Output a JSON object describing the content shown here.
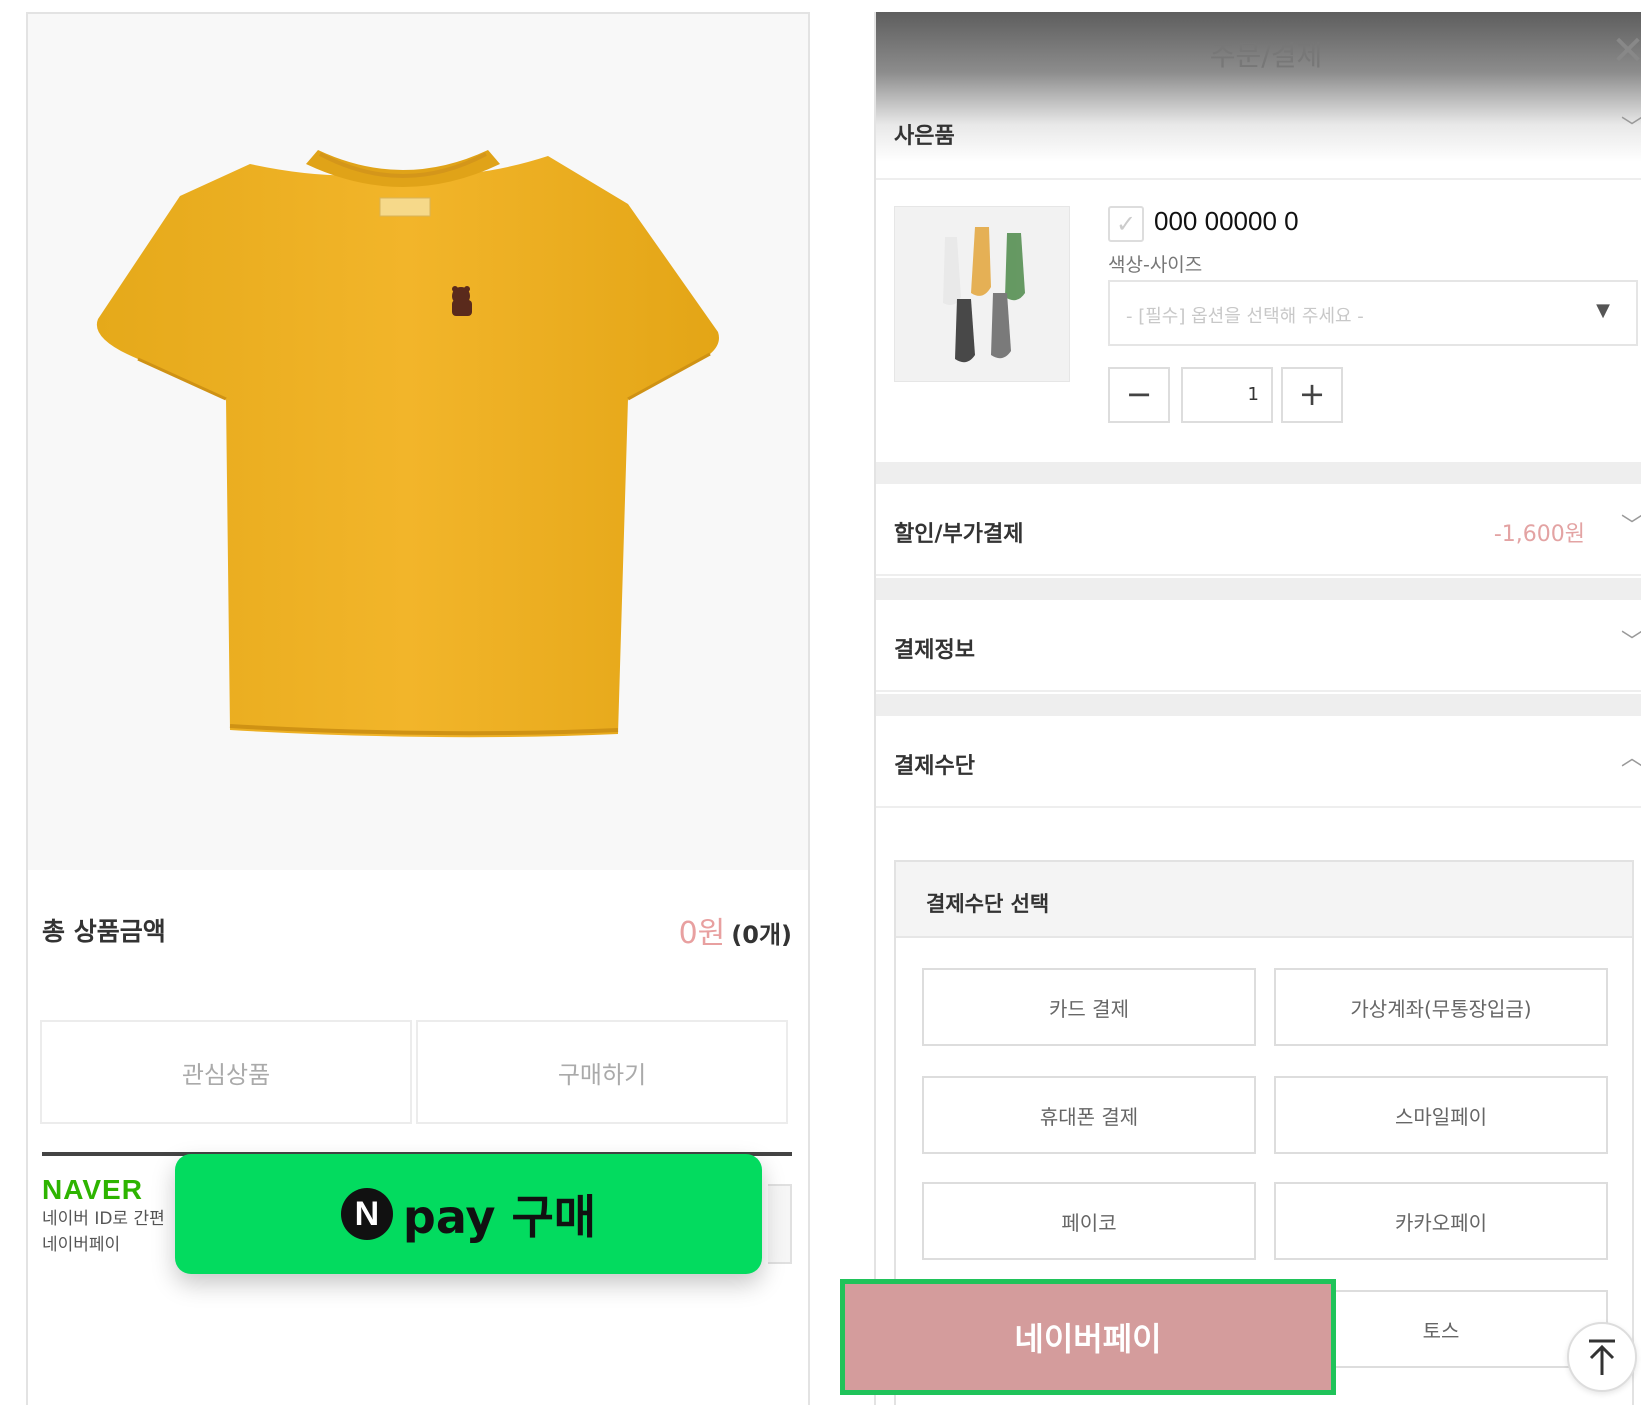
{
  "product": {
    "total_label": "총 상품금액",
    "total_price": "0원",
    "total_count": "(0개)",
    "wishlist_label": "관심상품",
    "buy_label": "구매하기",
    "naver_logo": "NAVER",
    "naver_desc_line1": "네이버 ID로 간편",
    "naver_desc_line2": "네이버페이",
    "npay_label": "pay 구매",
    "npay_logo_letter": "N",
    "image_icon": "yellow-tshirt-image"
  },
  "order": {
    "title": "주문/결제",
    "close_icon": "close-icon",
    "sections": {
      "gift": "사은품",
      "discount": "할인/부가결제",
      "discount_amount": "-1,600원",
      "payment_info": "결제정보",
      "payment_method": "결제수단"
    },
    "gift_item": {
      "name": "000 00000 0",
      "option_label": "색상-사이즈",
      "option_placeholder": "- [필수] 옵션을 선택해 주세요 -",
      "quantity": "1",
      "minus_label": "−",
      "plus_label": "+"
    },
    "method_box_title": "결제수단 선택",
    "methods": [
      "카드 결제",
      "가상계좌(무통장입금)",
      "휴대폰 결제",
      "스마일페이",
      "페이코",
      "카카오페이",
      "네이버페이",
      "토스"
    ]
  },
  "colors": {
    "npay_green": "#03db5f",
    "naver_green": "#2db400",
    "naverpay_btn": "#d49c9c",
    "highlight_border": "#20c35a",
    "discount_red": "#e3a3a3"
  }
}
